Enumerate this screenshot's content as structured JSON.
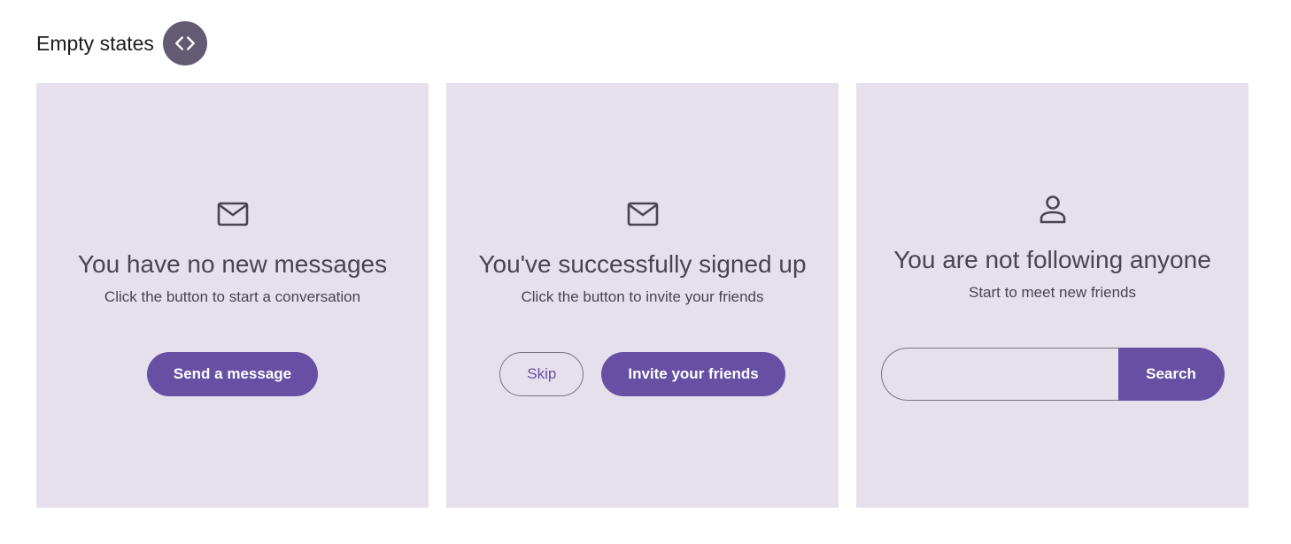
{
  "header": {
    "title": "Empty states",
    "code_icon": "code-icon"
  },
  "colors": {
    "card_bg": "#e6dfec",
    "primary": "#6750a4",
    "code_button_bg": "#625b71",
    "text": "#49454f"
  },
  "cards": [
    {
      "icon": "mail-icon",
      "title": "You have no new messages",
      "subtitle": "Click the button to start a conversation",
      "primary_button": "Send a message"
    },
    {
      "icon": "mail-icon",
      "title": "You've successfully signed up",
      "subtitle": "Click the button to invite your friends",
      "secondary_button": "Skip",
      "primary_button": "Invite your friends"
    },
    {
      "icon": "person-icon",
      "title": "You are not following anyone",
      "subtitle": "Start to meet new friends",
      "search_value": "",
      "search_button": "Search"
    }
  ]
}
